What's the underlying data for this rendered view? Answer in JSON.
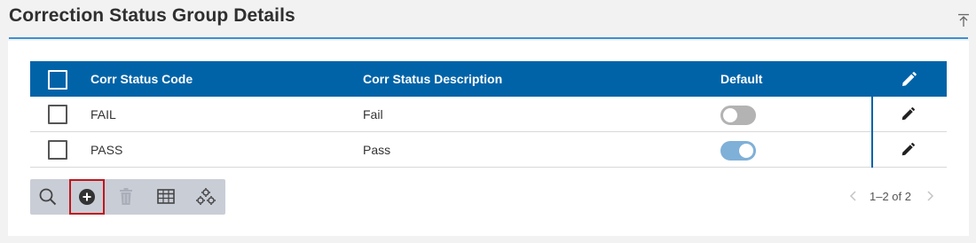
{
  "header": {
    "title": "Correction Status Group Details"
  },
  "table": {
    "columns": {
      "code": "Corr Status Code",
      "description": "Corr Status Description",
      "default": "Default"
    },
    "rows": [
      {
        "code": "FAIL",
        "description": "Fail",
        "default": false
      },
      {
        "code": "PASS",
        "description": "Pass",
        "default": true
      }
    ]
  },
  "toolbar": {
    "buttons": [
      "search-icon",
      "add-icon",
      "delete-icon",
      "columns-icon",
      "settings-icon"
    ],
    "selected": "add-icon"
  },
  "pager": {
    "text": "1–2 of 2"
  },
  "colors": {
    "accent": "#0063a8",
    "underline": "#3d8fd6",
    "toggle_on": "#7fb0d8",
    "toggle_off": "#b3b3b3",
    "selected_outline": "#c0151b"
  }
}
